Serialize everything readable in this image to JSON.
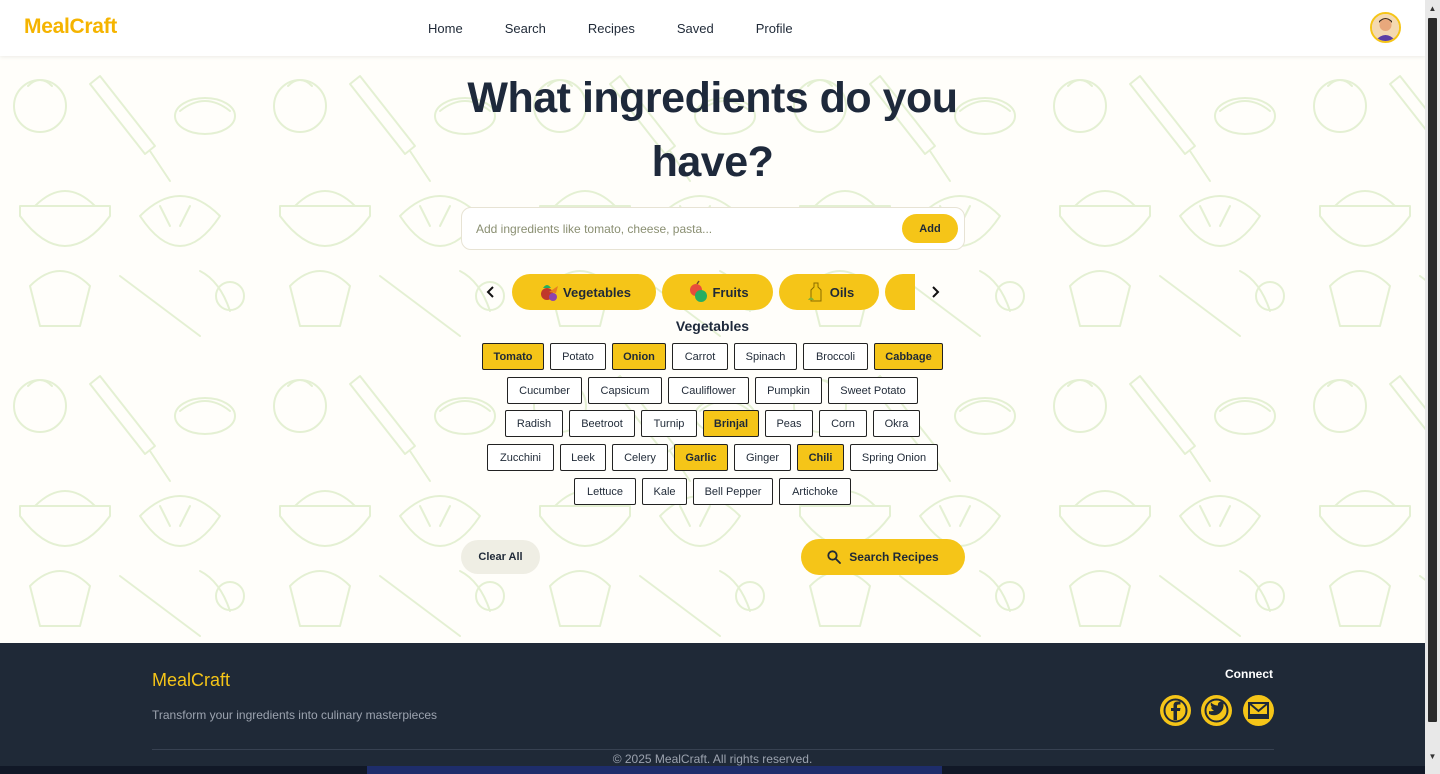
{
  "app": {
    "brand": "MealCraft"
  },
  "nav": {
    "items": [
      {
        "label": "Home"
      },
      {
        "label": "Search"
      },
      {
        "label": "Recipes"
      },
      {
        "label": "Saved"
      },
      {
        "label": "Profile"
      }
    ]
  },
  "hero": {
    "title_line1": "What ingredients do you",
    "title_line2": "have?"
  },
  "search": {
    "placeholder": "Add ingredients like tomato, cheese, pasta...",
    "value": "",
    "add_label": "Add"
  },
  "categories": {
    "items": [
      {
        "label": "Vegetables",
        "icon": "vegetables-icon"
      },
      {
        "label": "Fruits",
        "icon": "fruits-icon"
      },
      {
        "label": "Oils",
        "icon": "oils-icon"
      },
      {
        "label": "",
        "icon": ""
      }
    ]
  },
  "section": {
    "title": "Vegetables"
  },
  "ingredients": [
    {
      "label": "Tomato",
      "selected": true
    },
    {
      "label": "Potato",
      "selected": false
    },
    {
      "label": "Onion",
      "selected": true
    },
    {
      "label": "Carrot",
      "selected": false
    },
    {
      "label": "Spinach",
      "selected": false
    },
    {
      "label": "Broccoli",
      "selected": false
    },
    {
      "label": "Cabbage",
      "selected": true
    },
    {
      "label": "Cucumber",
      "selected": false
    },
    {
      "label": "Capsicum",
      "selected": false
    },
    {
      "label": "Cauliflower",
      "selected": false
    },
    {
      "label": "Pumpkin",
      "selected": false
    },
    {
      "label": "Sweet Potato",
      "selected": false
    },
    {
      "label": "Radish",
      "selected": false
    },
    {
      "label": "Beetroot",
      "selected": false
    },
    {
      "label": "Turnip",
      "selected": false
    },
    {
      "label": "Brinjal",
      "selected": true
    },
    {
      "label": "Peas",
      "selected": false
    },
    {
      "label": "Corn",
      "selected": false
    },
    {
      "label": "Okra",
      "selected": false
    },
    {
      "label": "Zucchini",
      "selected": false
    },
    {
      "label": "Leek",
      "selected": false
    },
    {
      "label": "Celery",
      "selected": false
    },
    {
      "label": "Garlic",
      "selected": true
    },
    {
      "label": "Ginger",
      "selected": false
    },
    {
      "label": "Chili",
      "selected": true
    },
    {
      "label": "Spring Onion",
      "selected": false
    },
    {
      "label": "Lettuce",
      "selected": false
    },
    {
      "label": "Kale",
      "selected": false
    },
    {
      "label": "Bell Pepper",
      "selected": false
    },
    {
      "label": "Artichoke",
      "selected": false
    }
  ],
  "actions": {
    "clear_label": "Clear All",
    "search_label": "Search Recipes"
  },
  "footer": {
    "brand": "MealCraft",
    "tagline": "Transform your ingredients into culinary masterpieces",
    "connect": "Connect",
    "social": [
      "facebook-icon",
      "twitter-icon",
      "mail-icon"
    ],
    "copyright": "© 2025 MealCraft. All rights reserved."
  },
  "colors": {
    "accent": "#f5c518",
    "brand": "#f5b400",
    "footer_bg": "#1f2937",
    "text_dark": "#1e293b"
  }
}
